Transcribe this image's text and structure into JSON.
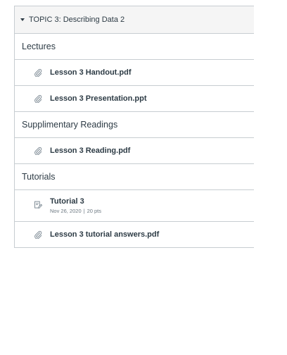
{
  "module": {
    "title": "TOPIC 3: Describing Data 2",
    "sections": [
      {
        "header": "Lectures",
        "items": [
          {
            "icon": "paperclip-icon",
            "title": "Lesson 3 Handout.pdf"
          },
          {
            "icon": "paperclip-icon",
            "title": "Lesson 3 Presentation.ppt"
          }
        ]
      },
      {
        "header": "Supplimentary Readings",
        "items": [
          {
            "icon": "paperclip-icon",
            "title": "Lesson 3 Reading.pdf"
          }
        ]
      },
      {
        "header": "Tutorials",
        "items": [
          {
            "icon": "assignment-icon",
            "title": "Tutorial 3",
            "date": "Nov 26, 2020",
            "separator": "|",
            "points": "20 pts"
          },
          {
            "icon": "paperclip-icon",
            "title": "Lesson 3 tutorial answers.pdf"
          }
        ]
      }
    ]
  },
  "colors": {
    "border": "#c7cdd1",
    "header_bg": "#f5f5f5",
    "text": "#2d3b45",
    "muted": "#6b7780",
    "icon": "#73818c"
  }
}
